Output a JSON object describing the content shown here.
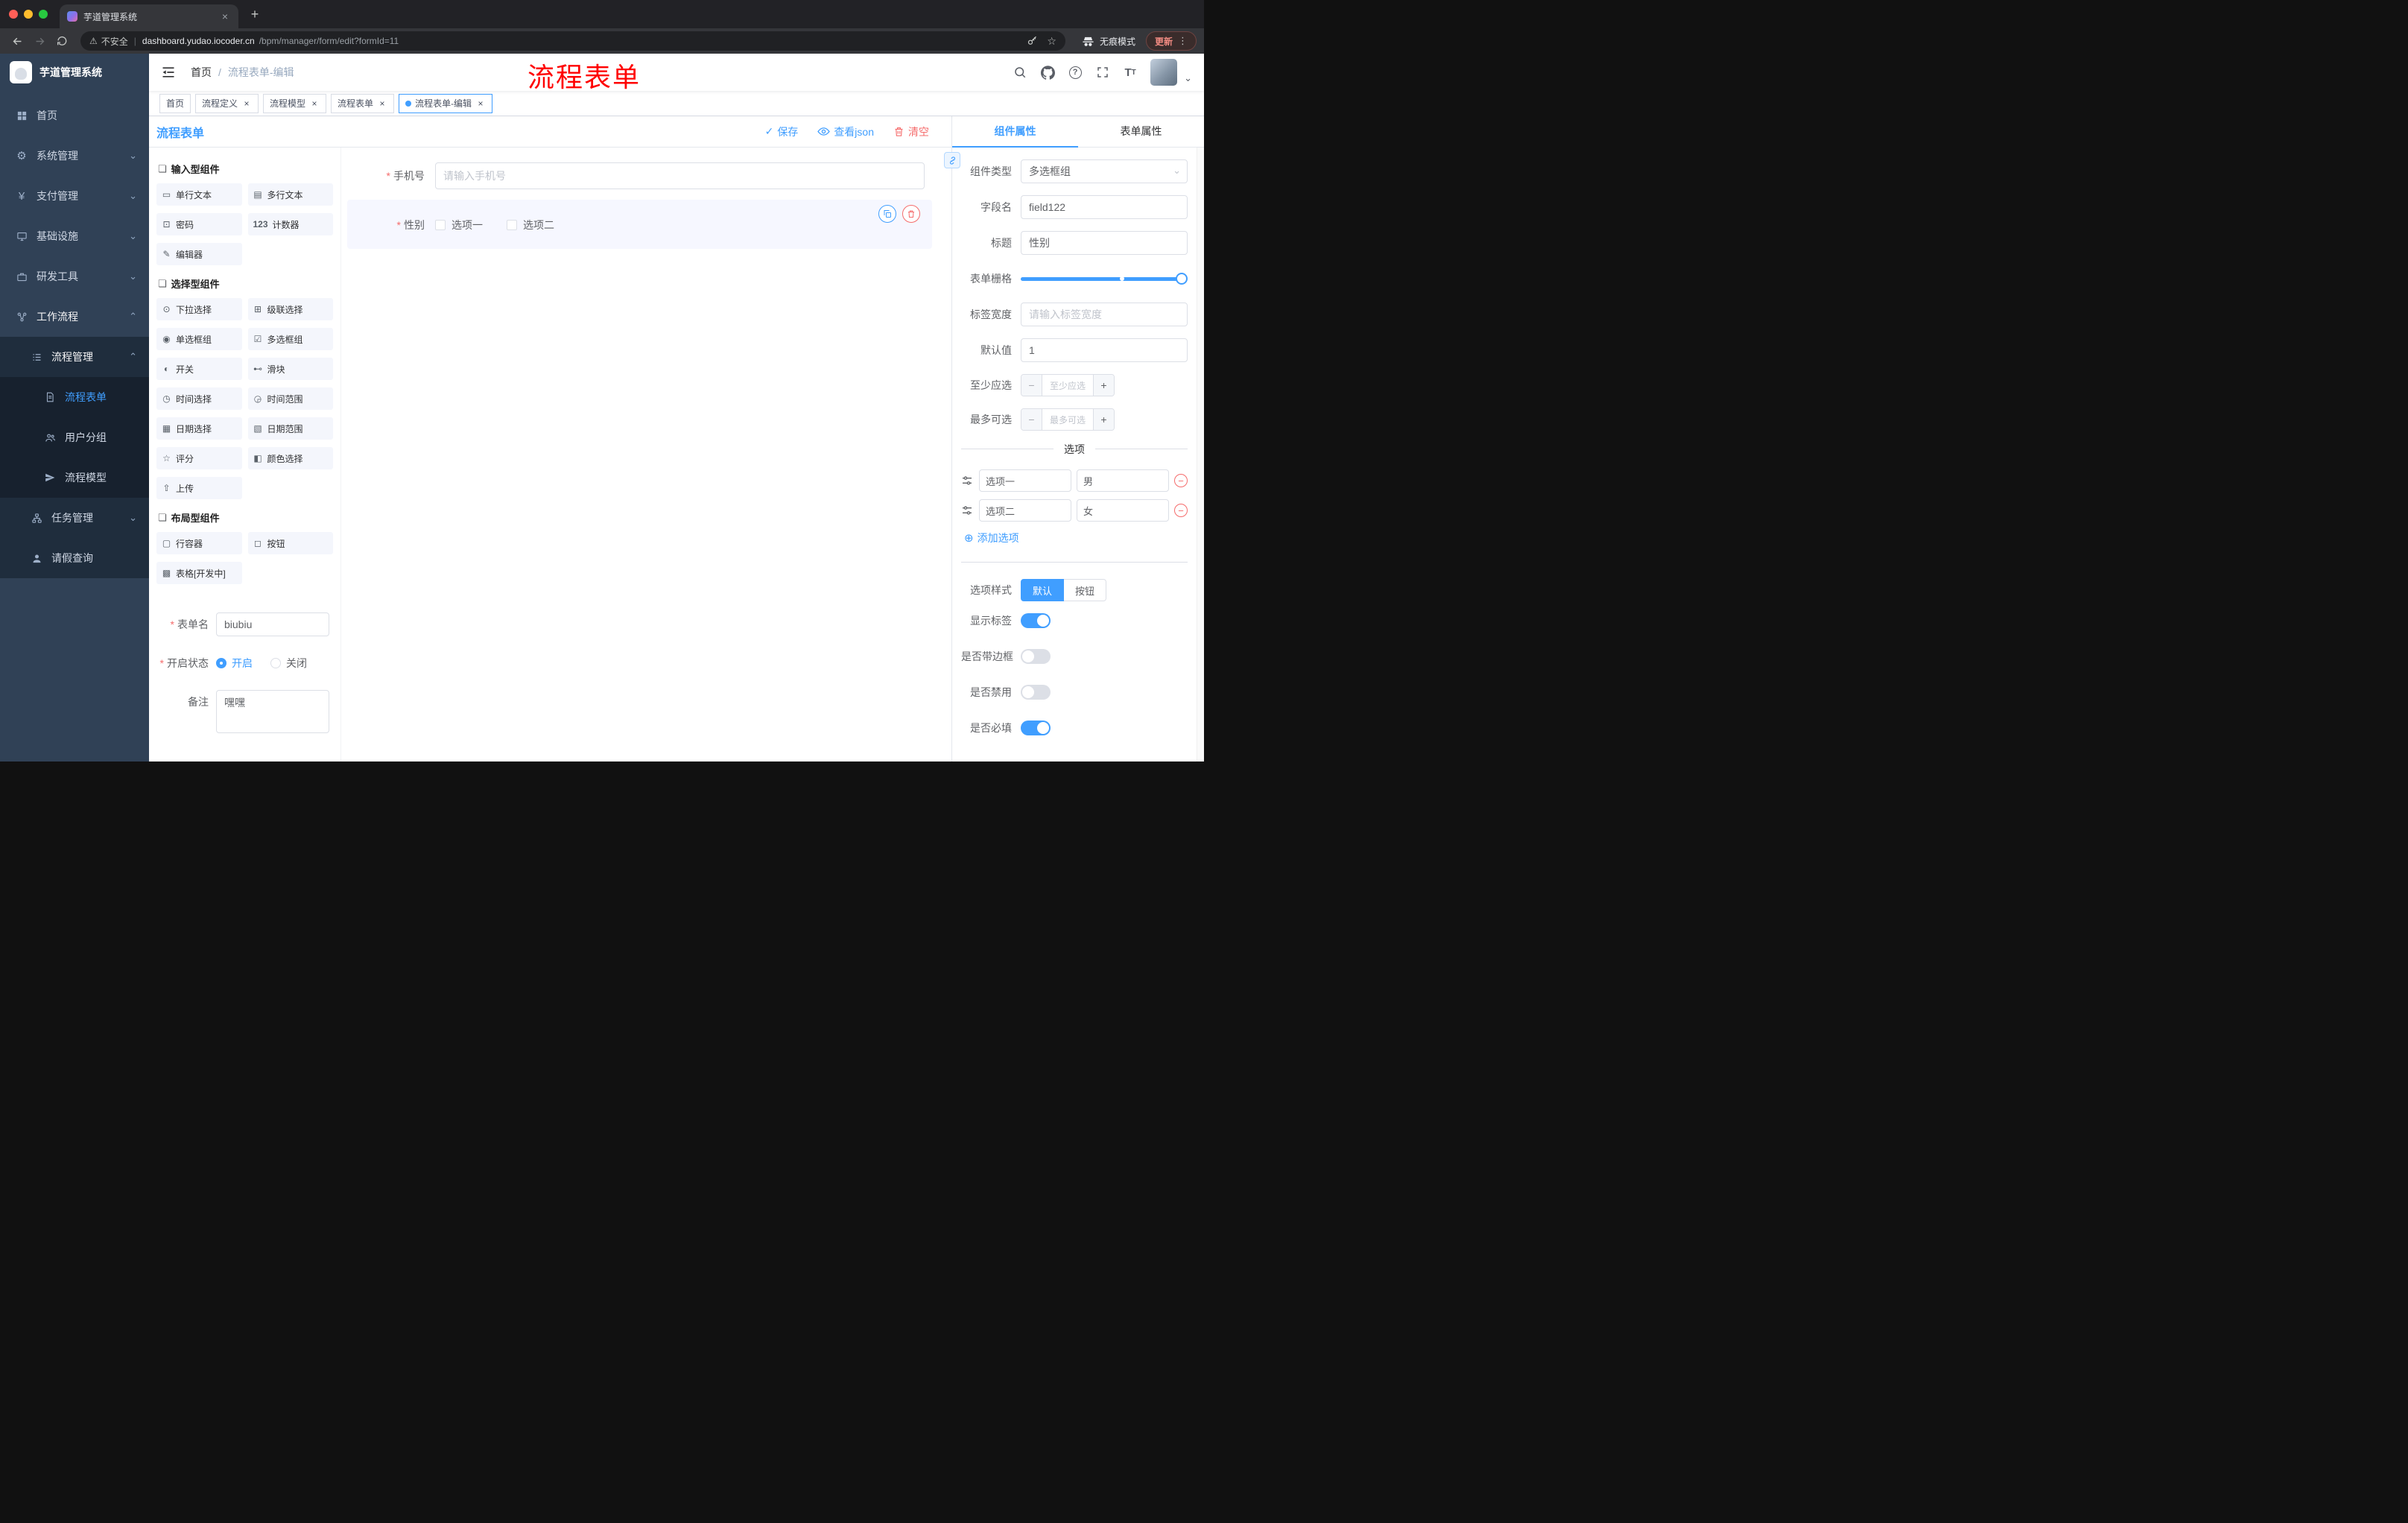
{
  "browser": {
    "tab_title": "芋道管理系统",
    "security": "不安全",
    "url_domain": "dashboard.yudao.iocoder.cn",
    "url_path": "/bpm/manager/form/edit?formId=11",
    "incognito": "无痕模式",
    "update": "更新"
  },
  "icons": {
    "group": "❏",
    "text_field": "▭",
    "textarea": "▤",
    "password": "⊡",
    "counter": "123",
    "editor": "✎",
    "select": "⊙",
    "cascader": "⊞",
    "radio_group": "◉",
    "checkbox_group": "☑",
    "switch": "◐",
    "slider": "⊷",
    "time": "◷",
    "time_range": "◶",
    "date": "▦",
    "date_range": "▧",
    "rate": "☆",
    "color": "◧",
    "upload": "⇧",
    "row": "▢",
    "button": "◻",
    "table": "▩",
    "gear": "⚙",
    "yen": "¥",
    "chevron_down": "⌄",
    "chevron_up": "⌃",
    "caret": "⌄",
    "close": "×",
    "plus": "+",
    "kebab": "⋮",
    "minus": "−",
    "plus_circle": "⊕",
    "warning": "⚠",
    "star": "☆",
    "check": "✓",
    "question": "?",
    "font_big": "T",
    "font_small": "T"
  },
  "sidebar": {
    "logo_title": "芋道管理系统",
    "menu": [
      {
        "label": "首页"
      },
      {
        "label": "系统管理"
      },
      {
        "label": "支付管理"
      },
      {
        "label": "基础设施"
      },
      {
        "label": "研发工具"
      },
      {
        "label": "工作流程"
      }
    ],
    "submenu": {
      "process": "流程管理",
      "process_children": [
        {
          "label": "流程表单"
        },
        {
          "label": "用户分组"
        },
        {
          "label": "流程模型"
        }
      ],
      "task": "任务管理",
      "leave": "请假查询"
    }
  },
  "header": {
    "breadcrumb_home": "首页",
    "breadcrumb_sep": "/",
    "breadcrumb_current": "流程表单-编辑",
    "watermark": "流程表单"
  },
  "tags": [
    {
      "label": "首页"
    },
    {
      "label": "流程定义"
    },
    {
      "label": "流程模型"
    },
    {
      "label": "流程表单"
    },
    {
      "label": "流程表单-编辑"
    }
  ],
  "designer": {
    "title": "流程表单",
    "save": "保存",
    "view_json": "查看json",
    "clear": "清空",
    "groups": [
      {
        "title": "输入型组件",
        "items": [
          {
            "label": "单行文本"
          },
          {
            "label": "多行文本"
          },
          {
            "label": "密码"
          },
          {
            "label": "计数器"
          },
          {
            "label": "编辑器"
          }
        ]
      },
      {
        "title": "选择型组件",
        "items": [
          {
            "label": "下拉选择"
          },
          {
            "label": "级联选择"
          },
          {
            "label": "单选框组"
          },
          {
            "label": "多选框组"
          },
          {
            "label": "开关"
          },
          {
            "label": "滑块"
          },
          {
            "label": "时间选择"
          },
          {
            "label": "时间范围"
          },
          {
            "label": "日期选择"
          },
          {
            "label": "日期范围"
          },
          {
            "label": "评分"
          },
          {
            "label": "颜色选择"
          },
          {
            "label": "上传"
          }
        ]
      },
      {
        "title": "布局型组件",
        "items": [
          {
            "label": "行容器"
          },
          {
            "label": "按钮"
          },
          {
            "label": "表格[开发中]"
          }
        ]
      }
    ],
    "meta": {
      "form_name_label": "表单名",
      "form_name_value": "biubiu",
      "status_label": "开启状态",
      "status_on": "开启",
      "status_off": "关闭",
      "remark_label": "备注",
      "remark_value": "嘿嘿"
    },
    "canvas": {
      "phone_label": "手机号",
      "phone_placeholder": "请输入手机号",
      "gender_label": "性别",
      "gender_options": [
        {
          "label": "选项一"
        },
        {
          "label": "选项二"
        }
      ]
    }
  },
  "props": {
    "tab_component": "组件属性",
    "tab_form": "表单属性",
    "component_type_label": "组件类型",
    "component_type_value": "多选框组",
    "field_name_label": "字段名",
    "field_name_value": "field122",
    "title_label": "标题",
    "title_value": "性别",
    "grid_label": "表单栅格",
    "label_width_label": "标签宽度",
    "label_width_placeholder": "请输入标签宽度",
    "default_label": "默认值",
    "default_value": "1",
    "min_label": "至少应选",
    "min_placeholder": "至少应选",
    "max_label": "最多可选",
    "max_placeholder": "最多可选",
    "options_title": "选项",
    "options": [
      {
        "name": "选项一",
        "value": "男"
      },
      {
        "name": "选项二",
        "value": "女"
      }
    ],
    "add_option": "添加选项",
    "style_label": "选项样式",
    "style_default": "默认",
    "style_button": "按钮",
    "toggles": [
      {
        "label": "显示标签",
        "on": true
      },
      {
        "label": "是否带边框",
        "on": false
      },
      {
        "label": "是否禁用",
        "on": false
      },
      {
        "label": "是否必填",
        "on": true
      }
    ]
  },
  "colors": {
    "accent": "#409EFF",
    "danger": "#F56C6C",
    "watermark": "#FF0000",
    "sidebar_bg": "#304156"
  }
}
